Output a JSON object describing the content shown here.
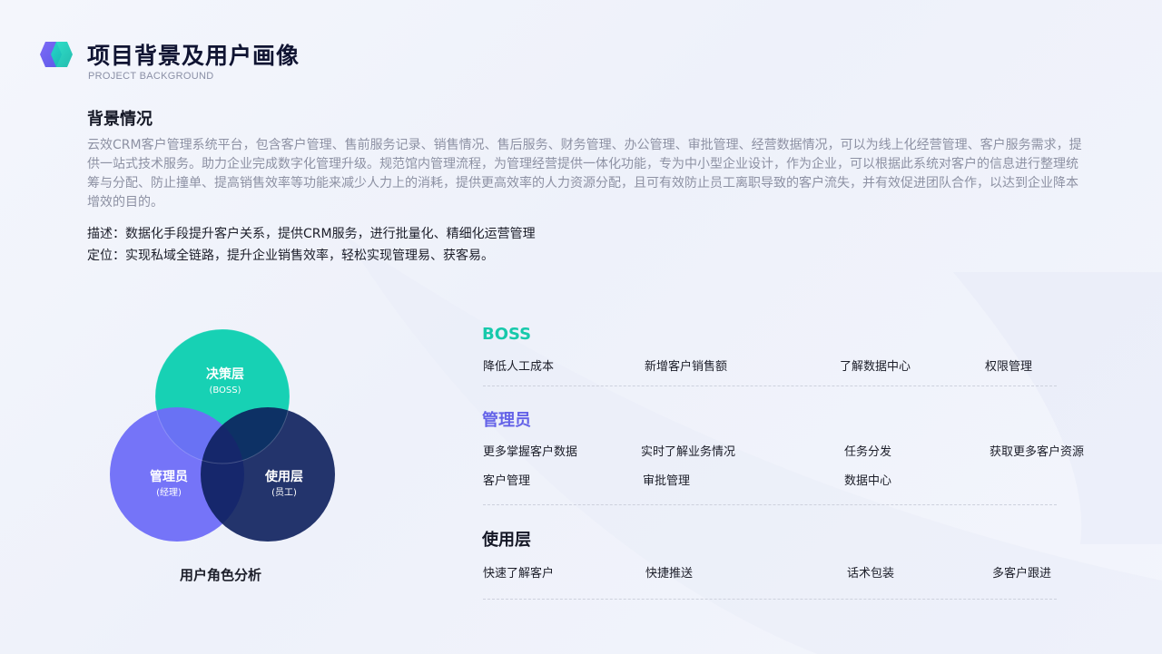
{
  "header": {
    "title": "项目背景及用户画像",
    "subtitle": "PROJECT BACKGROUND"
  },
  "background": {
    "heading": "背景情况",
    "paragraph": "云效CRM客户管理系统平台，包含客户管理、售前服务记录、销售情况、售后服务、财务管理、办公管理、审批管理、经营数据情况，可以为线上化经营管理、客户服务需求，提供一站式技术服务。助力企业完成数字化管理升级。规范馆内管理流程，为管理经营提供一体化功能，专为中小型企业设计，作为企业，可以根据此系统对客户的信息进行整理统筹与分配、防止撞单、提高销售效率等功能来减少人力上的消耗，提供更高效率的人力资源分配，且可有效防止员工离职导致的客户流失，并有效促进团队合作，以达到企业降本增效的目的。",
    "description": "描述：数据化手段提升客户关系，提供CRM服务，进行批量化、精细化运营管理",
    "positioning": "定位：实现私域全链路，提升企业销售效率，轻松实现管理易、获客易。"
  },
  "venn": {
    "caption": "用户角色分析",
    "circles": [
      {
        "label": "决策层",
        "sub": "(BOSS)",
        "color": "#17d1b4"
      },
      {
        "label": "管理员",
        "sub": "(经理)",
        "color": "#6e6df8"
      },
      {
        "label": "使用层",
        "sub": "(员工)",
        "color": "#0c1f5c"
      }
    ]
  },
  "roles": {
    "boss": {
      "title": "BOSS",
      "color": "#17c9ab",
      "items": [
        "降低人工成本",
        "新增客户销售额",
        "了解数据中心",
        "权限管理"
      ]
    },
    "admin": {
      "title": "管理员",
      "color": "#6563e8",
      "items": [
        "更多掌握客户数据",
        "实时了解业务情况",
        "任务分发",
        "获取更多客户资源",
        "客户管理",
        "审批管理",
        "数据中心"
      ]
    },
    "user": {
      "title": "使用层",
      "color": "#151826",
      "items": [
        "快速了解客户",
        "快捷推送",
        "话术包装",
        "多客户跟进"
      ]
    }
  }
}
